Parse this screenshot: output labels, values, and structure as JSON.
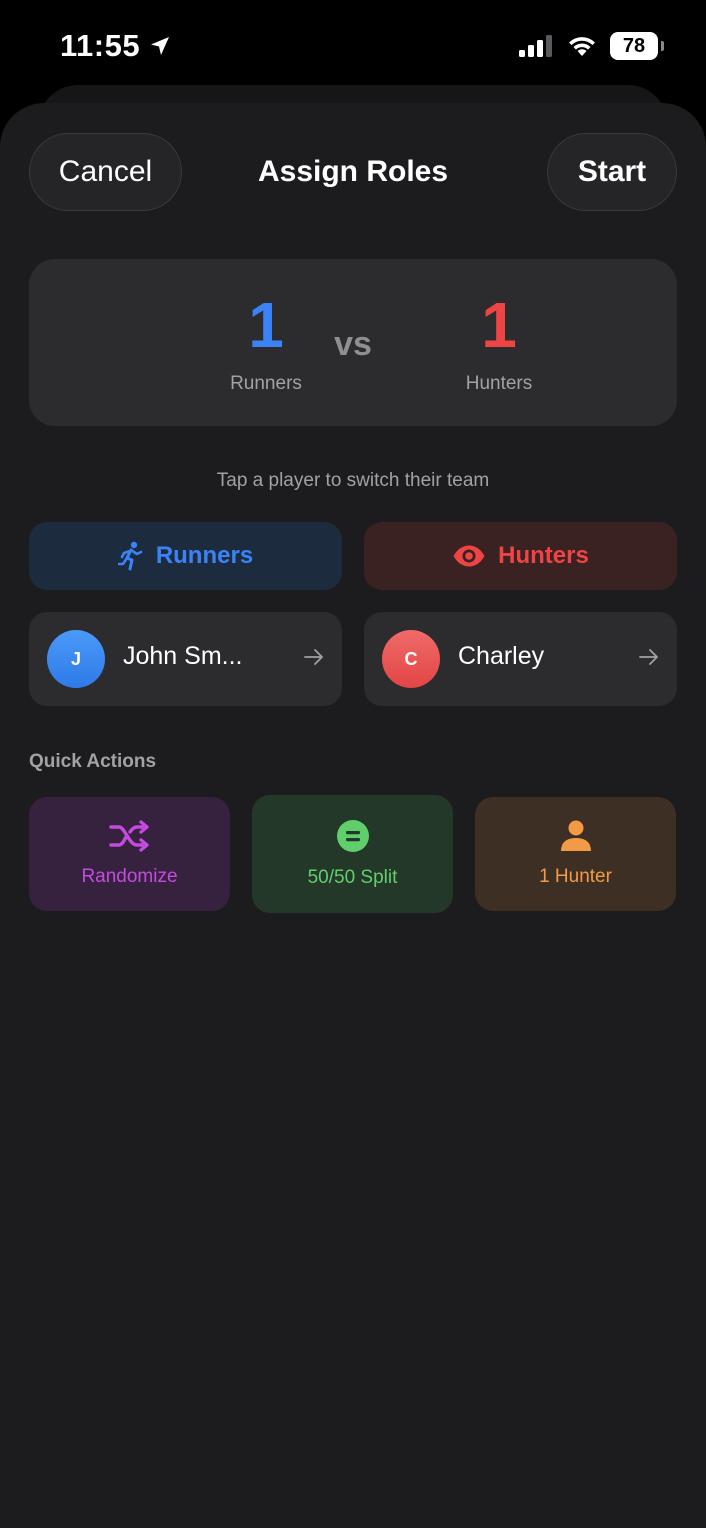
{
  "status_bar": {
    "time": "11:55",
    "battery": "78"
  },
  "header": {
    "cancel_label": "Cancel",
    "title": "Assign Roles",
    "start_label": "Start"
  },
  "score": {
    "runners_count": "1",
    "runners_label": "Runners",
    "vs": "vs",
    "hunters_count": "1",
    "hunters_label": "Hunters"
  },
  "hint": "Tap a player to switch their team",
  "teams": {
    "runners_label": "Runners",
    "hunters_label": "Hunters"
  },
  "players": {
    "runners": [
      {
        "initial": "J",
        "name": "John Sm..."
      }
    ],
    "hunters": [
      {
        "initial": "C",
        "name": "Charley"
      }
    ]
  },
  "quick_actions": {
    "title": "Quick Actions",
    "items": [
      {
        "label": "Randomize",
        "icon": "shuffle-icon"
      },
      {
        "label": "50/50 Split",
        "icon": "equals-circle-icon"
      },
      {
        "label": "1 Hunter",
        "icon": "person-icon"
      }
    ]
  },
  "colors": {
    "runners": "#3b82f6",
    "hunters": "#ef4444",
    "randomize": "#c54be0",
    "split": "#5fcf6c",
    "one_hunter": "#f39a46"
  }
}
